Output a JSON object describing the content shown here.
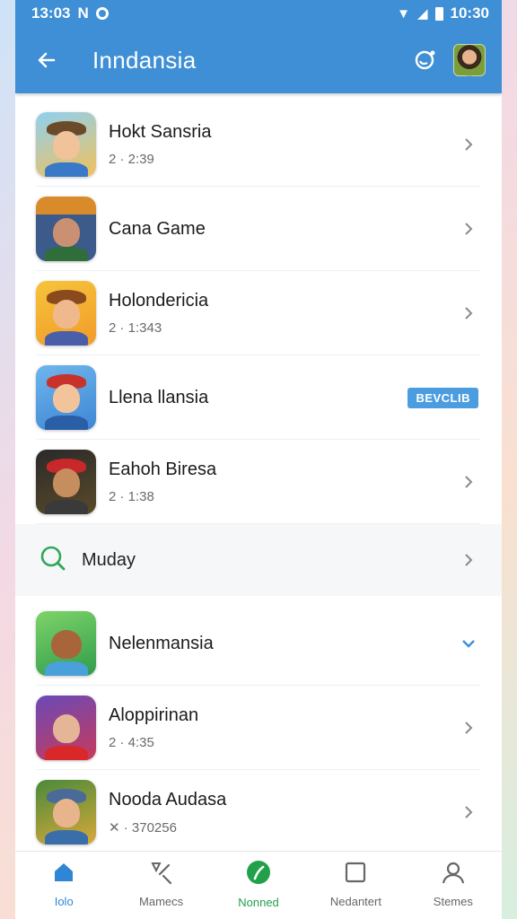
{
  "status": {
    "time": "13:03",
    "left_glyph": "N",
    "right_time": "10:30"
  },
  "appbar": {
    "title": "Inndansia"
  },
  "items": [
    {
      "title": "Hokt Sansria",
      "sub": "2 · 2:39",
      "trailing": "chevron"
    },
    {
      "title": "Cana Game",
      "sub": "",
      "trailing": "chevron"
    },
    {
      "title": "Holondericia",
      "sub": "2 · 1:343",
      "trailing": "chevron"
    },
    {
      "title": "Llena llansia",
      "sub": "",
      "trailing": "badge",
      "badge": "BEVCLIB"
    },
    {
      "title": "Eahoh Biresa",
      "sub": "2 · 1:38",
      "trailing": "chevron"
    }
  ],
  "section": {
    "label": "Muday"
  },
  "items2": [
    {
      "title": "Nelenmansia",
      "sub": "",
      "trailing": "chevron-down"
    },
    {
      "title": "Aloppirinan",
      "sub": "2 · 4:35",
      "trailing": "chevron"
    },
    {
      "title": "Nooda Audasa",
      "sub": "✕ · 370256",
      "trailing": "chevron"
    }
  ],
  "nav": [
    {
      "label": "Iolo",
      "icon": "home-icon"
    },
    {
      "label": "Mamecs",
      "icon": "tools-icon"
    },
    {
      "label": "Nonned",
      "icon": "circle-logo-icon"
    },
    {
      "label": "Nedantert",
      "icon": "square-icon"
    },
    {
      "label": "Stemes",
      "icon": "profile-icon"
    }
  ],
  "colors": {
    "primary": "#3e8fd6",
    "accent_green": "#22a04a",
    "badge": "#4b9ddf"
  }
}
